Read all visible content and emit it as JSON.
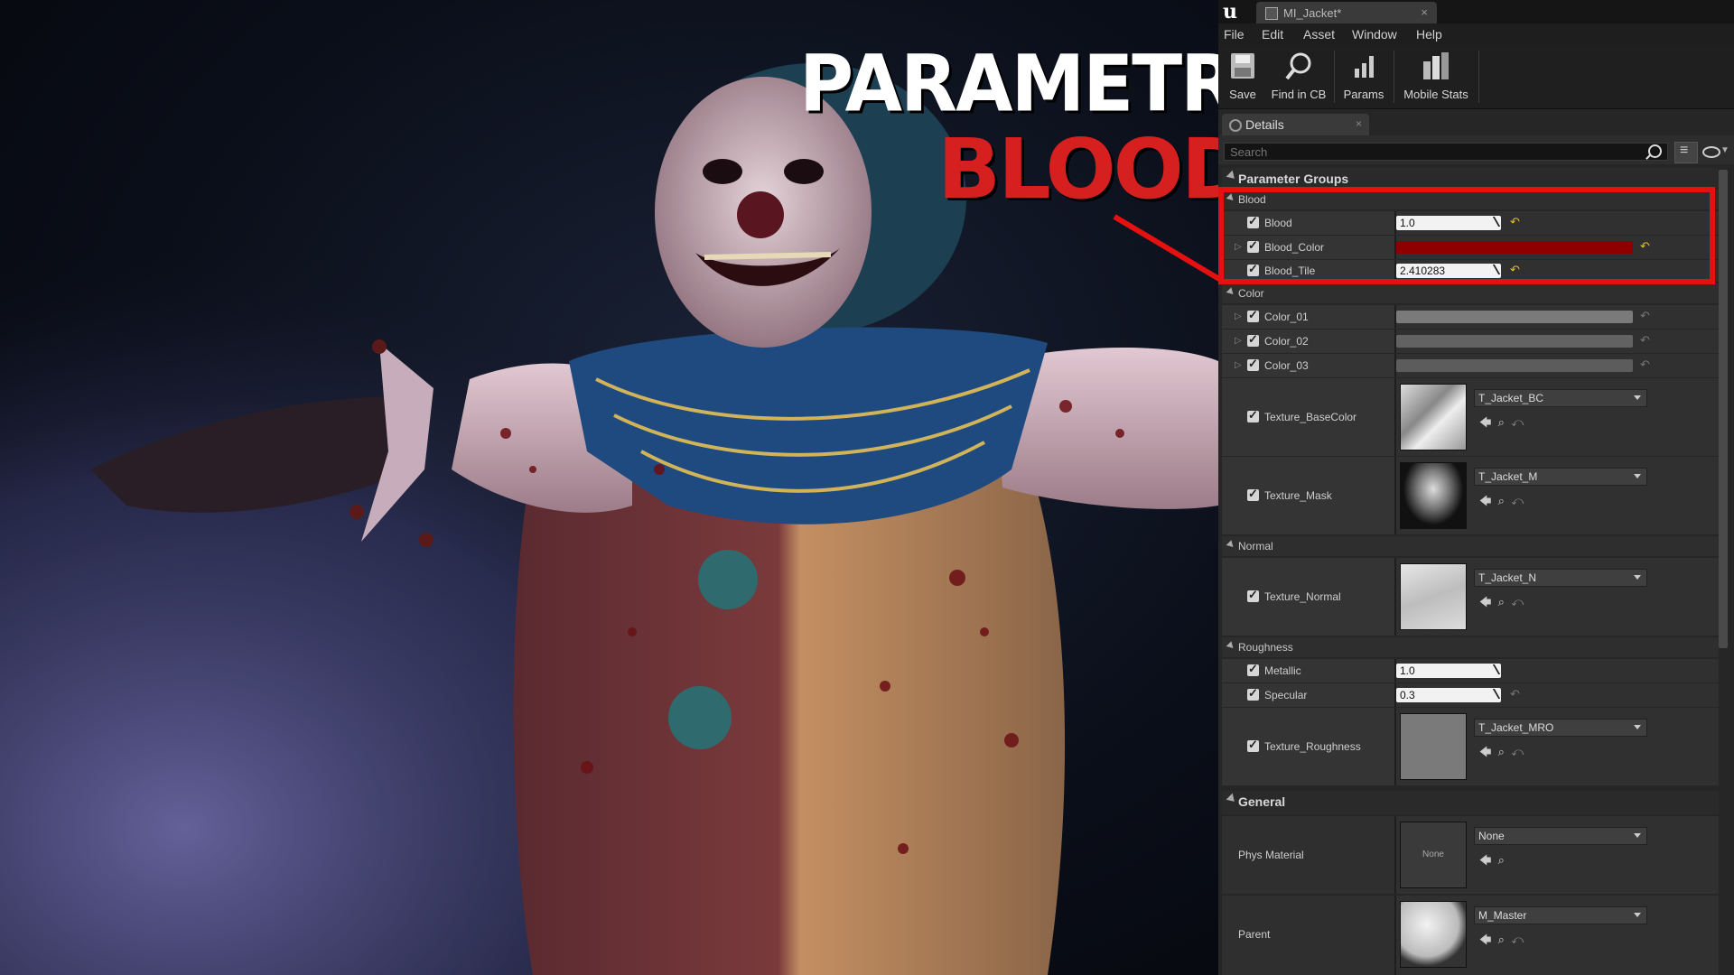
{
  "overlay": {
    "title_line1": "PARAMETRIC",
    "title_line2": "BLOOD"
  },
  "window": {
    "logo": "u",
    "tab_label": "MI_Jacket*",
    "tab_close": "×"
  },
  "menu": [
    "File",
    "Edit",
    "Asset",
    "Window",
    "Help"
  ],
  "toolbar": {
    "save": "Save",
    "find": "Find in CB",
    "params": "Params",
    "mobile": "Mobile Stats"
  },
  "details": {
    "tab_label": "Details",
    "tab_close": "×",
    "search_placeholder": "Search"
  },
  "groups": {
    "parameter_groups": "Parameter Groups",
    "blood": "Blood",
    "color": "Color",
    "normal": "Normal",
    "roughness": "Roughness",
    "general": "General"
  },
  "params": {
    "blood": {
      "name": "Blood",
      "value": "1.0"
    },
    "blood_color": {
      "name": "Blood_Color",
      "color": "#8e0000"
    },
    "blood_tile": {
      "name": "Blood_Tile",
      "value": "2.410283"
    },
    "color_01": {
      "name": "Color_01",
      "color": "#7a7a7a"
    },
    "color_02": {
      "name": "Color_02",
      "color": "#626262"
    },
    "color_03": {
      "name": "Color_03",
      "color": "#5c5c5c"
    },
    "texture_basecolor": {
      "name": "Texture_BaseColor",
      "asset": "T_Jacket_BC"
    },
    "texture_mask": {
      "name": "Texture_Mask",
      "asset": "T_Jacket_M"
    },
    "texture_normal": {
      "name": "Texture_Normal",
      "asset": "T_Jacket_N"
    },
    "metallic": {
      "name": "Metallic",
      "value": "1.0"
    },
    "specular": {
      "name": "Specular",
      "value": "0.3"
    },
    "texture_roughness": {
      "name": "Texture_Roughness",
      "asset": "T_Jacket_MRO"
    }
  },
  "general": {
    "phys_material": {
      "name": "Phys Material",
      "asset": "None",
      "thumb_text": "None"
    },
    "parent": {
      "name": "Parent",
      "asset": "M_Master"
    }
  },
  "colors": {
    "highlight": "#e51010",
    "blood_text": "#d61f1f",
    "reset_active": "#e0c22a"
  }
}
